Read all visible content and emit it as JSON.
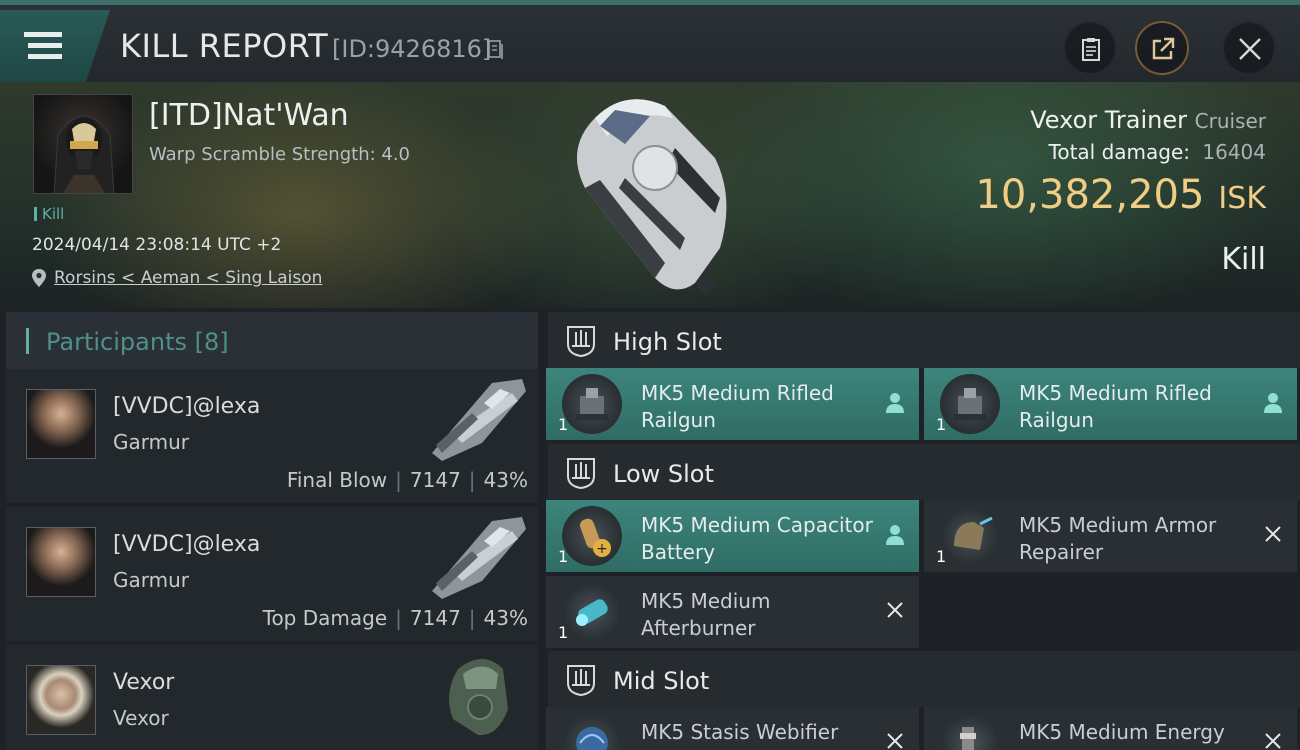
{
  "header": {
    "title": "KILL REPORT",
    "report_id": "[ID:9426816]"
  },
  "victim": {
    "name": "[ITD]Nat'Wan",
    "warp_scramble": "Warp Scramble Strength: 4.0",
    "kill_tag": "Kill",
    "timestamp": "2024/04/14 23:08:14 UTC +2",
    "location": "Rorsins < Aeman < Sing Laison"
  },
  "ship": {
    "name": "Vexor Trainer",
    "class": "Cruiser",
    "total_damage_label": "Total damage:",
    "total_damage": "16404",
    "value": "10,382,205",
    "currency": "ISK",
    "result": "Kill"
  },
  "participants": {
    "label": "Participants",
    "count": "[8]",
    "items": [
      {
        "name": "[VVDC]@lexa",
        "ship": "Garmur",
        "role": "Final Blow",
        "damage": "7147",
        "percent": "43%"
      },
      {
        "name": "[VVDC]@lexa",
        "ship": "Garmur",
        "role": "Top Damage",
        "damage": "7147",
        "percent": "43%"
      },
      {
        "name": "Vexor",
        "ship": "Vexor"
      }
    ]
  },
  "fitting": {
    "high_slot": {
      "label": "High Slot",
      "modules": [
        {
          "name": "MK5 Medium Rifled Railgun",
          "qty": "1",
          "status": "dropped"
        },
        {
          "name": "MK5 Medium Rifled Railgun",
          "qty": "1",
          "status": "dropped"
        }
      ]
    },
    "low_slot": {
      "label": "Low Slot",
      "modules": [
        {
          "name": "MK5 Medium Capacitor Battery",
          "qty": "1",
          "status": "dropped"
        },
        {
          "name": "MK5 Medium Armor Repairer",
          "qty": "1",
          "status": "destroyed"
        },
        {
          "name": "MK5 Medium Afterburner",
          "qty": "1",
          "status": "destroyed"
        }
      ]
    },
    "mid_slot": {
      "label": "Mid Slot",
      "modules": [
        {
          "name": "MK5 Stasis Webifier",
          "qty": "1",
          "status": "destroyed"
        },
        {
          "name": "MK5 Medium Energy",
          "qty": "1",
          "status": "destroyed"
        }
      ]
    }
  },
  "colors": {
    "accent_teal": "#3d857c",
    "isk_gold": "#f0cd85",
    "tag_teal": "#5fb0a6"
  },
  "icons": [
    "menu-icon",
    "copy-icon",
    "notes-icon",
    "share-icon",
    "close-icon",
    "pin-icon",
    "slot-icon",
    "pilot-icon",
    "destroyed-x-icon"
  ]
}
